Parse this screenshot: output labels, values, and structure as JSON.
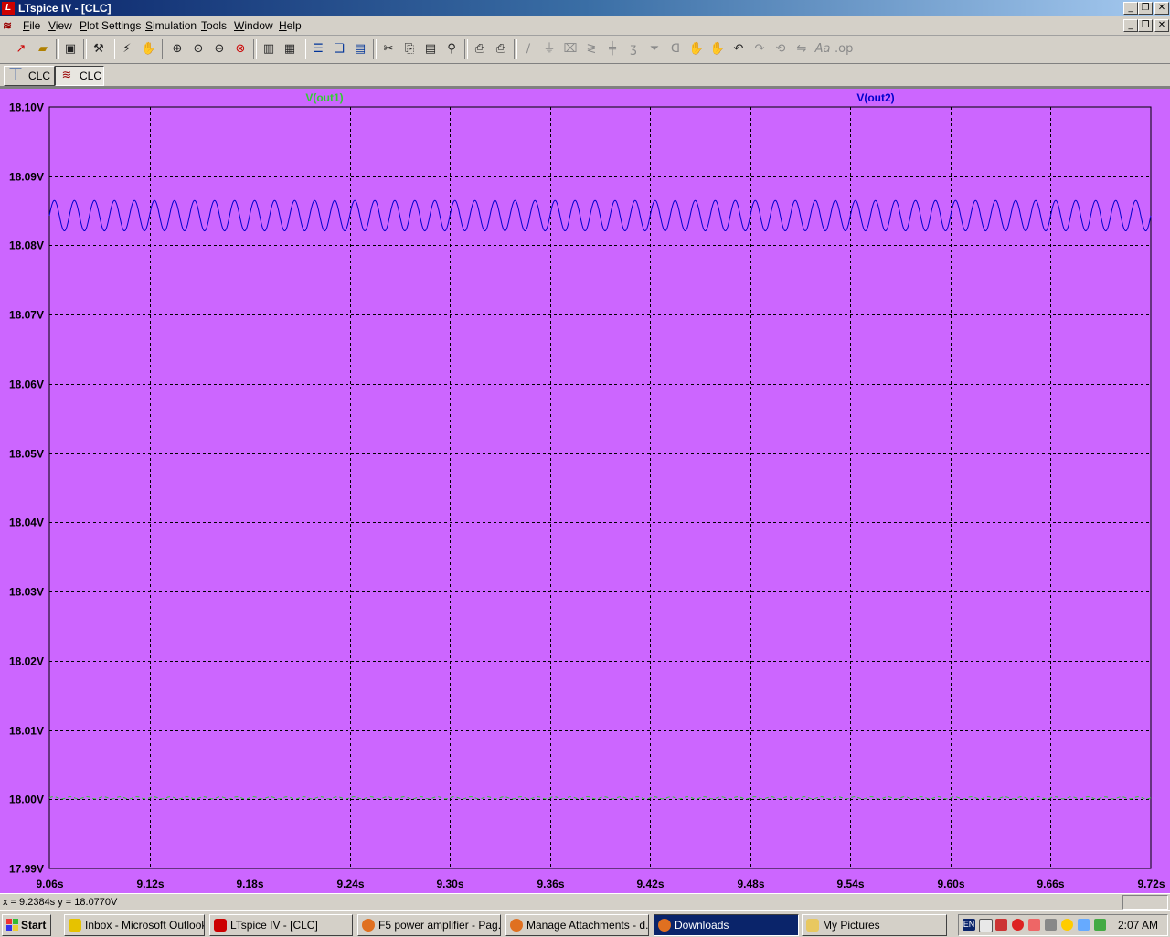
{
  "window": {
    "title": "LTspice IV - [CLC]"
  },
  "menu": [
    "File",
    "View",
    "Plot Settings",
    "Simulation",
    "Tools",
    "Window",
    "Help"
  ],
  "toolbar_icons": [
    "new-schematic-icon",
    "open-icon",
    "save-icon",
    "control-panel-icon",
    "run-icon",
    "pan-icon",
    "zoom-in-icon",
    "zoom-area-icon",
    "zoom-out-icon",
    "zoom-cancel-icon",
    "autorange-icon",
    "plot-settings-icon",
    "tile-horizontal-icon",
    "cascade-icon",
    "tile-vertical-icon",
    "cut-icon",
    "copy-icon",
    "paste-icon",
    "find-icon",
    "print-preview-icon",
    "print-icon",
    "wire-icon",
    "ground-icon",
    "label-icon",
    "resistor-icon",
    "capacitor-icon",
    "inductor-icon",
    "diode-icon",
    "component-icon",
    "move-icon",
    "drag-icon",
    "undo-icon",
    "redo-icon",
    "rotate-icon",
    "mirror-icon",
    "text-icon",
    "spice-directive-icon"
  ],
  "tabs": [
    {
      "label": "CLC",
      "icon": "schematic-icon",
      "active": false
    },
    {
      "label": "CLC",
      "icon": "waveform-icon",
      "active": true
    }
  ],
  "chart_data": {
    "type": "line",
    "title": "",
    "xlabel": "",
    "ylabel": "",
    "xlim": [
      9.06,
      9.72
    ],
    "ylim": [
      17.99,
      18.1
    ],
    "x_ticks": [
      "9.06s",
      "9.12s",
      "9.18s",
      "9.24s",
      "9.30s",
      "9.36s",
      "9.42s",
      "9.48s",
      "9.54s",
      "9.60s",
      "9.66s",
      "9.72s"
    ],
    "y_ticks": [
      "18.10V",
      "18.09V",
      "18.08V",
      "18.07V",
      "18.06V",
      "18.05V",
      "18.04V",
      "18.03V",
      "18.02V",
      "18.01V",
      "18.00V",
      "17.99V"
    ],
    "grid": true,
    "background": "#cc66ff",
    "series": [
      {
        "name": "V(out1)",
        "color": "#33cc33",
        "dashed": true,
        "center": 18.0002,
        "amplitude": 0.00015,
        "period": 0.01,
        "x_start": 9.06,
        "x_end": 9.72
      },
      {
        "name": "V(out2)",
        "color": "#0000cc",
        "dashed": false,
        "center": 18.0843,
        "amplitude": 0.0022,
        "period": 0.012,
        "x_start": 9.06,
        "x_end": 9.72
      }
    ]
  },
  "status": {
    "coords": "x = 9.2384s   y = 18.0770V"
  },
  "taskbar": {
    "start": "Start",
    "tasks": [
      {
        "label": "Inbox - Microsoft Outlook",
        "icon": "outlook-icon",
        "active": false
      },
      {
        "label": "LTspice IV - [CLC]",
        "icon": "ltspice-icon",
        "active": false
      },
      {
        "label": "F5 power amplifier - Pag...",
        "icon": "firefox-icon",
        "active": false
      },
      {
        "label": "Manage Attachments - d...",
        "icon": "firefox-icon",
        "active": false
      },
      {
        "label": "Downloads",
        "icon": "firefox-icon",
        "active": true
      },
      {
        "label": "My Pictures",
        "icon": "folder-icon",
        "active": false
      }
    ],
    "tray_icons": [
      "language-icon",
      "mail-icon",
      "shield-icon",
      "antivirus-icon",
      "network-icon",
      "volume-icon",
      "messenger-icon",
      "display-icon",
      "connection-icon"
    ],
    "language": "EN",
    "clock": "2:07 AM"
  },
  "colors": {
    "titlebar": "#0a246a",
    "plot_bg": "#cc66ff",
    "grid": "#000000"
  }
}
